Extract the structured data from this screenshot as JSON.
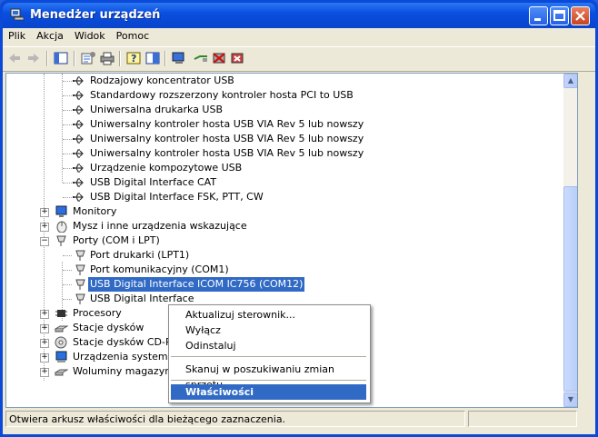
{
  "window": {
    "title": "Menedżer urządzeń"
  },
  "menu": [
    "Plik",
    "Akcja",
    "Widok",
    "Pomoc"
  ],
  "toolbar_icons": [
    "back-icon",
    "forward-icon",
    "show-hide-tree-icon",
    "properties-icon",
    "print-icon",
    "help-icon",
    "view-icon",
    "scan-hardware-icon",
    "update-driver-icon",
    "disable-icon",
    "uninstall-icon"
  ],
  "tree": {
    "usb_children": [
      "Rodzajowy koncentrator USB",
      "Standardowy rozszerzony kontroler hosta PCI to USB",
      "Uniwersalna drukarka USB",
      "Uniwersalny kontroler hosta USB VIA Rev 5 lub nowszy",
      "Uniwersalny kontroler hosta USB VIA Rev 5 lub nowszy",
      "Uniwersalny kontroler hosta USB VIA Rev 5 lub nowszy",
      "Urządzenie kompozytowe USB",
      "USB Digital Interface CAT",
      "USB Digital Interface FSK, PTT, CW"
    ],
    "monitors": "Monitory",
    "mouse": "Mysz i inne urządzenia wskazujące",
    "ports": "Porty (COM i LPT)",
    "port_children": [
      "Port drukarki (LPT1)",
      "Port komunikacyjny (COM1)",
      "USB Digital Interface ICOM IC756 (COM12)",
      "USB Digital Interface"
    ],
    "after": [
      "Procesory",
      "Stacje dysków",
      "Stacje dysków CD-ROM",
      "Urządzenia systemowe",
      "Woluminy magazynu"
    ]
  },
  "context_menu": {
    "items": [
      "Aktualizuj sterownik...",
      "Wyłącz",
      "Odinstaluj",
      "Skanuj w poszukiwaniu zmian sprzętu",
      "Właściwości"
    ],
    "highlighted": "Właściwości"
  },
  "status": "Otwiera arkusz właściwości dla bieżącego zaznaczenia.",
  "colors": {
    "titlebar": "#0a4fe0",
    "selection": "#316ac5",
    "face": "#ece9d8"
  }
}
